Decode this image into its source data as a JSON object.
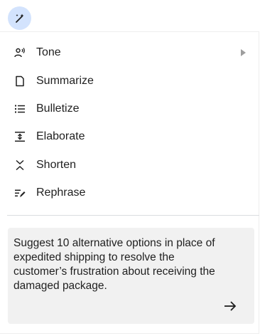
{
  "menu": {
    "items": [
      {
        "label": "Tone",
        "icon": "voice-tone-icon",
        "has_submenu": true
      },
      {
        "label": "Summarize",
        "icon": "document-icon"
      },
      {
        "label": "Bulletize",
        "icon": "bulleted-list-icon"
      },
      {
        "label": "Elaborate",
        "icon": "expand-vertical-icon"
      },
      {
        "label": "Shorten",
        "icon": "collapse-vertical-icon"
      },
      {
        "label": "Rephrase",
        "icon": "rephrase-pen-icon"
      }
    ]
  },
  "prompt": {
    "text": "Suggest 10 alternative options in place of expedited shipping to resolve the customer’s frustration about receiving the damaged package."
  },
  "colors": {
    "fab_background": "#d3e3fd",
    "prompt_background": "#f1f1f1",
    "text": "#1f1f1f"
  }
}
